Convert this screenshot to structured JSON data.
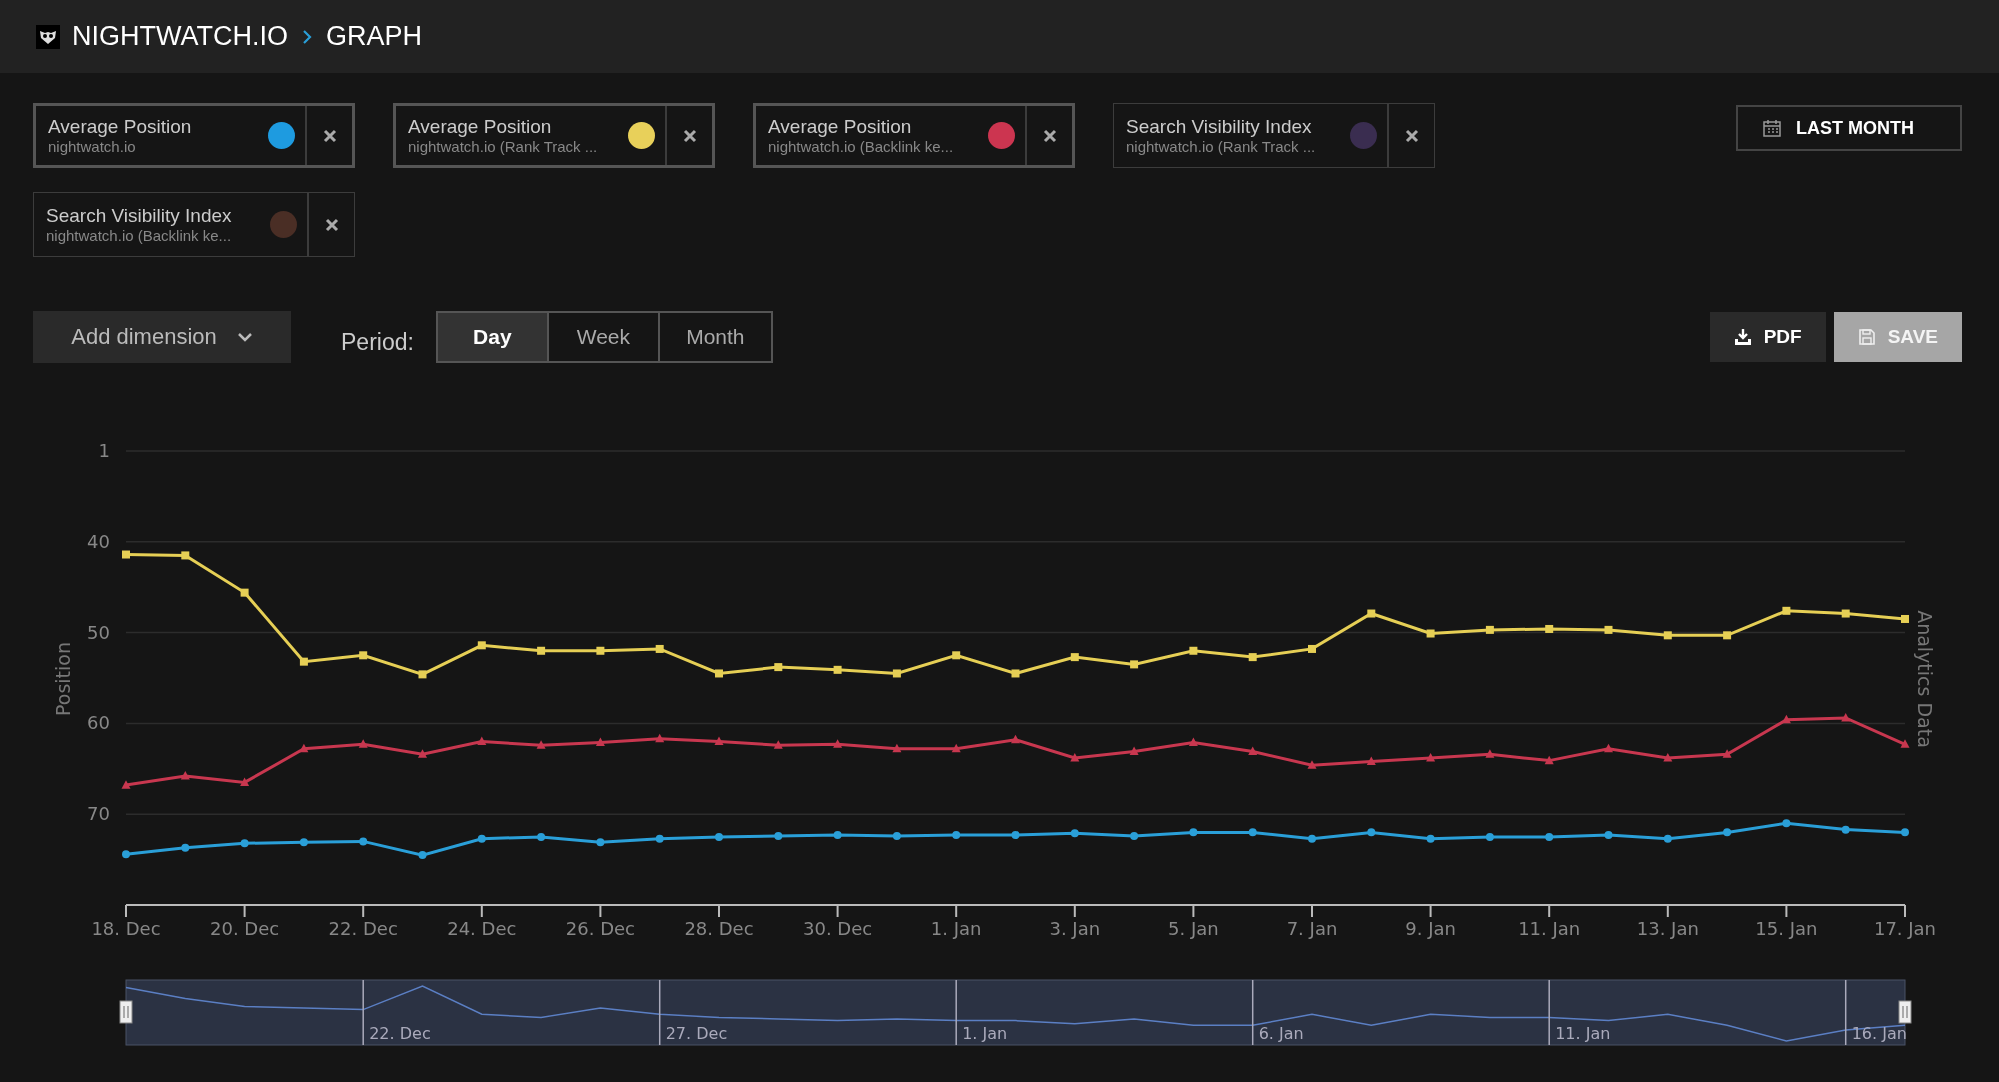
{
  "header": {
    "brand": "NIGHTWATCH.IO",
    "page": "GRAPH"
  },
  "metrics": [
    {
      "title": "Average Position",
      "subtitle": "nightwatch.io",
      "color": "#1e9be0",
      "active": true
    },
    {
      "title": "Average Position",
      "subtitle": "nightwatch.io (Rank Track ...",
      "color": "#e8d05a",
      "active": true
    },
    {
      "title": "Average Position",
      "subtitle": "nightwatch.io (Backlink ke...",
      "color": "#cc3550",
      "active": true
    },
    {
      "title": "Search Visibility Index",
      "subtitle": "nightwatch.io (Rank Track ...",
      "color": "#3a2d50",
      "active": false
    },
    {
      "title": "Search Visibility Index",
      "subtitle": "nightwatch.io (Backlink ke...",
      "color": "#4a2e25",
      "active": false
    }
  ],
  "date_range": {
    "label": "LAST MONTH"
  },
  "add_dimension": {
    "label": "Add dimension"
  },
  "period": {
    "label": "Period:",
    "options": [
      {
        "label": "Day",
        "selected": true
      },
      {
        "label": "Week",
        "selected": false
      },
      {
        "label": "Month",
        "selected": false
      }
    ]
  },
  "actions": [
    {
      "label": "PDF",
      "kind": "download"
    },
    {
      "label": "SAVE",
      "kind": "save"
    }
  ],
  "chart": {
    "chart_data": {
      "type": "line",
      "ylabel": "Position",
      "y2label": "Analytics Data",
      "categories": [
        "18. Dec",
        null,
        "20. Dec",
        null,
        "22. Dec",
        null,
        "24. Dec",
        null,
        "26. Dec",
        null,
        "28. Dec",
        null,
        "30. Dec",
        null,
        "1. Jan",
        null,
        "3. Jan",
        null,
        "5. Jan",
        null,
        "7. Jan",
        null,
        "9. Jan",
        null,
        "11. Jan",
        null,
        "13. Jan",
        null,
        "15. Jan",
        null,
        "17. Jan"
      ],
      "yticks": [
        40,
        50,
        60,
        70
      ],
      "grid": true,
      "ylim": [
        80,
        30
      ],
      "series": [
        {
          "color": "#e6cf55",
          "marker": "square",
          "values": [
            41.4,
            41.5,
            45.6,
            53.2,
            52.5,
            54.6,
            51.4,
            52.0,
            52.0,
            51.8,
            54.5,
            53.8,
            54.1,
            54.5,
            52.5,
            54.5,
            52.7,
            53.5,
            52.0,
            52.7,
            51.8,
            47.9,
            50.1,
            49.7,
            49.6,
            49.7,
            50.3,
            50.3,
            47.6,
            47.9,
            48.5
          ]
        },
        {
          "color": "#c8374f",
          "marker": "triangle",
          "values": [
            66.8,
            65.8,
            66.5,
            62.8,
            62.3,
            63.4,
            62.0,
            62.4,
            62.1,
            61.7,
            62.0,
            62.4,
            62.3,
            62.8,
            62.8,
            61.8,
            63.8,
            63.1,
            62.1,
            63.1,
            64.6,
            64.2,
            63.8,
            63.4,
            64.1,
            62.8,
            63.8,
            63.4,
            59.6,
            59.4,
            62.3
          ]
        },
        {
          "color": "#2a9fd8",
          "marker": "circle",
          "values": [
            74.4,
            73.7,
            73.2,
            73.1,
            73.0,
            74.5,
            72.7,
            72.5,
            73.1,
            72.7,
            72.5,
            72.4,
            72.3,
            72.4,
            72.3,
            72.3,
            72.1,
            72.4,
            72.0,
            72.0,
            72.7,
            72.0,
            72.7,
            72.5,
            72.5,
            72.3,
            72.7,
            72.0,
            71.0,
            71.7,
            72.0
          ]
        }
      ]
    },
    "axis_top_label": "1"
  },
  "navigator": {
    "labels": [
      "22. Dec",
      "27. Dec",
      "1. Jan",
      "6. Jan",
      "11. Jan",
      "16. Jan"
    ]
  }
}
